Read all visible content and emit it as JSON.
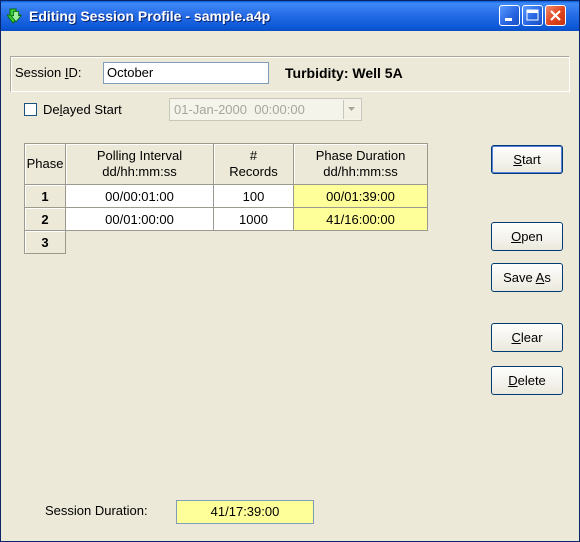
{
  "window": {
    "title": "Editing Session Profile - sample.a4p"
  },
  "session": {
    "id_label_prefix": "Session ",
    "id_label_accel": "I",
    "id_label_suffix": "D:",
    "id_value": "October",
    "profile_name": "Turbidity: Well 5A"
  },
  "delayed_start": {
    "label_prefix": "De",
    "label_accel": "l",
    "label_suffix": "ayed Start",
    "checked": false,
    "datetime": "01-Jan-2000  00:00:00"
  },
  "grid": {
    "headers": {
      "phase": "Phase",
      "polling_line1": "Polling Interval",
      "polling_line2": "dd/hh:mm:ss",
      "records_line1": "#",
      "records_line2": "Records",
      "duration_line1": "Phase Duration",
      "duration_line2": "dd/hh:mm:ss"
    },
    "rows": [
      {
        "phase": "1",
        "interval": "00/00:01:00",
        "records": "100",
        "duration": "00/01:39:00"
      },
      {
        "phase": "2",
        "interval": "00/01:00:00",
        "records": "1000",
        "duration": "41/16:00:00"
      },
      {
        "phase": "3"
      }
    ]
  },
  "buttons": {
    "start": {
      "accel": "S",
      "rest": "tart"
    },
    "open": {
      "accel": "O",
      "rest": "pen"
    },
    "save_as": {
      "pre": "Save ",
      "accel": "A",
      "rest": "s"
    },
    "clear": {
      "accel": "C",
      "rest": "lear"
    },
    "delete": {
      "accel": "D",
      "rest": "elete"
    }
  },
  "footer": {
    "duration_label": "Session Duration:",
    "duration_value": "41/17:39:00"
  },
  "colors": {
    "title_bar": "#0b58d8",
    "highlight": "#ffff99",
    "face": "#ece9d8"
  }
}
